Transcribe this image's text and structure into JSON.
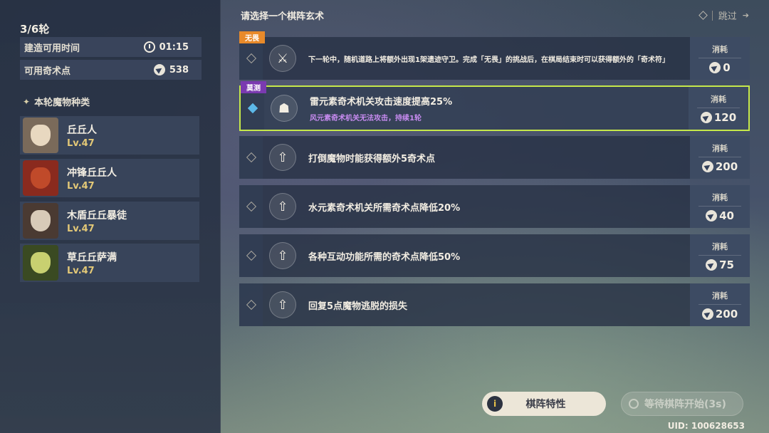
{
  "left": {
    "round": "3/6轮",
    "build_time": {
      "label": "建造可用时间",
      "value": "01:15"
    },
    "magic_points": {
      "label": "可用奇术点",
      "value": "538"
    },
    "section_title": "本轮魔物种类",
    "monsters": [
      {
        "name": "丘丘人",
        "level": "Lv.47"
      },
      {
        "name": "冲锋丘丘人",
        "level": "Lv.47"
      },
      {
        "name": "木盾丘丘暴徒",
        "level": "Lv.47"
      },
      {
        "name": "草丘丘萨满",
        "level": "Lv.47"
      }
    ]
  },
  "header": {
    "title": "请选择一个棋阵玄术",
    "skip_label": "跳过"
  },
  "options": [
    {
      "tag": "无畏",
      "desc": "下一轮中，随机道路上将额外出现1架遗迹守卫。完成「无畏」的挑战后，在棋局结束时可以获得额外的「奇术符」",
      "sub": "",
      "cost_label": "消耗",
      "cost": "0",
      "icon": "crossed-swords-icon"
    },
    {
      "tag": "莫测",
      "desc": "雷元素奇术机关攻击速度提高25%",
      "sub": "风元素奇术机关无法攻击，持续1轮",
      "cost_label": "消耗",
      "cost": "120",
      "icon": "mask-icon"
    },
    {
      "tag": "",
      "desc": "打倒魔物时能获得额外5奇术点",
      "sub": "",
      "cost_label": "消耗",
      "cost": "200",
      "icon": "up-arrow-icon"
    },
    {
      "tag": "",
      "desc": "水元素奇术机关所需奇术点降低20%",
      "sub": "",
      "cost_label": "消耗",
      "cost": "40",
      "icon": "up-arrow-icon"
    },
    {
      "tag": "",
      "desc": "各种互动功能所需的奇术点降低50%",
      "sub": "",
      "cost_label": "消耗",
      "cost": "75",
      "icon": "up-arrow-icon"
    },
    {
      "tag": "",
      "desc": "回复5点魔物逃脱的损失",
      "sub": "",
      "cost_label": "消耗",
      "cost": "200",
      "icon": "up-arrow-icon"
    }
  ],
  "buttons": {
    "traits": "棋阵特性",
    "wait": "等待棋阵开始(3s)"
  },
  "uid": "UID: 100628653",
  "colors": {
    "selected_border": "#c6e84a",
    "level_gold": "#e3c877",
    "sub_purple": "#c78bf0",
    "tag_orange": "#e88a2a",
    "tag_purple": "#7a3ab0"
  }
}
